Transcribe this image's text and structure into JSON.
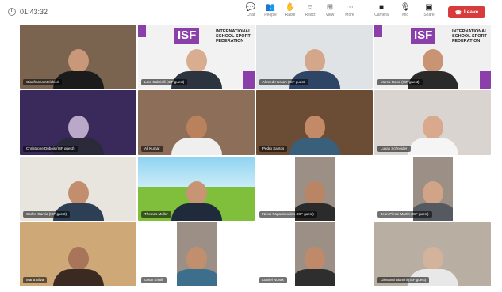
{
  "toolbar": {
    "timer": "01:43:32",
    "tools": [
      {
        "label": "Chat",
        "glyph": "💬",
        "icon": "chat-icon"
      },
      {
        "label": "People",
        "glyph": "👥",
        "icon": "people-icon"
      },
      {
        "label": "Raise",
        "glyph": "✋",
        "icon": "raise-hand-icon"
      },
      {
        "label": "React",
        "glyph": "☺",
        "icon": "react-icon"
      },
      {
        "label": "View",
        "glyph": "⊞",
        "icon": "view-icon"
      },
      {
        "label": "More",
        "glyph": "⋯",
        "icon": "more-icon"
      }
    ],
    "camera_label": "Camera",
    "mic_label": "Mic",
    "share_label": "Share",
    "leave_label": "Leave"
  },
  "tiles": [
    {
      "name": "Gianfranco Melchiori",
      "bg": "#7a6450",
      "skin": "#c9977a",
      "shirt": "#1b1b1b"
    },
    {
      "name": "Lara Gabrielli (ISF guest)",
      "bg": "#f2f2f2",
      "skin": "#d9ad8f",
      "shirt": "#2c3440"
    },
    {
      "name": "Ahmed Hassan (ISF guest)",
      "bg": "#dfe3e6",
      "skin": "#d5a78a",
      "shirt": "#2e4566"
    },
    {
      "name": "Marco Rossi (ISF guest)",
      "bg": "#f0f0f0",
      "skin": "#c99474",
      "shirt": "#2a2a2a"
    },
    {
      "name": "Christophe Dubois (ISF guest)",
      "bg": "#3a2a5c",
      "skin": "#b9a8c8",
      "shirt": "#2a2a3a"
    },
    {
      "name": "Ali Kumar",
      "bg": "#8d6e58",
      "skin": "#b9825d",
      "shirt": "#efefef"
    },
    {
      "name": "Pedro Santos",
      "bg": "#6b4c34",
      "skin": "#c28a66",
      "shirt": "#3a5f7a"
    },
    {
      "name": "Lukas Schneider",
      "bg": "#d9d4cf",
      "skin": "#d8a98c",
      "shirt": "#f5f5f5"
    },
    {
      "name": "Carlos Garcia (ISF guest)",
      "bg": "#e8e4de",
      "skin": "#c38e6e",
      "shirt": "#2c3f55"
    },
    {
      "name": "Thomas Muller",
      "bg": "#7fbf3b",
      "skin": "#c79474",
      "shirt": "#1f2b3a"
    },
    {
      "name": "Nikos Papadopoulos (ISF guest)",
      "bg": "#ffffff",
      "skin": "#b98565",
      "shirt": "#2b2b2b"
    },
    {
      "name": "Jean-Pierre Martin (ISF guest)",
      "bg": "#ffffff",
      "skin": "#d2a487",
      "shirt": "#555a60"
    },
    {
      "name": "Maria Silva",
      "bg": "#cfa877",
      "skin": "#a8745a",
      "shirt": "#3a2a22"
    },
    {
      "name": "Omar Khalil",
      "bg": "#ffffff",
      "skin": "#c18f6e",
      "shirt": "#3d6f8c"
    },
    {
      "name": "Daniel Novak",
      "bg": "#ffffff",
      "skin": "#bf8a6a",
      "shirt": "#2e2e2e"
    },
    {
      "name": "Giovanni Bianchi (ISF guest)",
      "bg": "#b9aea2",
      "skin": "#d4b39c",
      "shirt": "#e8e8e8"
    }
  ]
}
